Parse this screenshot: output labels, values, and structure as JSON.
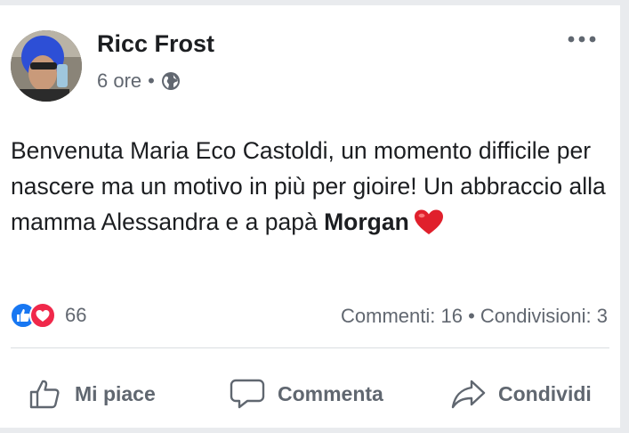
{
  "post": {
    "author": "Ricc Frost",
    "time": "6 ore",
    "separator": "•",
    "privacy_icon": "globe-icon",
    "text_part1": "Benvenuta Maria Eco Castoldi, un momento difficile per nascere ma un motivo in più per gioire! Un abbraccio alla mamma Alessandra e a papà ",
    "text_bold": "Morgan",
    "emoji": "heart"
  },
  "reactions": {
    "icons": [
      "like-icon",
      "love-icon"
    ],
    "count": "66"
  },
  "stats": {
    "comments": "Commenti: 16",
    "separator": "•",
    "shares": "Condivisioni: 3"
  },
  "actions": {
    "like": "Mi piace",
    "comment": "Commenta",
    "share": "Condividi"
  },
  "colors": {
    "like_blue": "#1877f2",
    "love_red": "#f0284a",
    "heart_red": "#e0202c",
    "text": "#1c1e21",
    "secondary": "#606770"
  }
}
